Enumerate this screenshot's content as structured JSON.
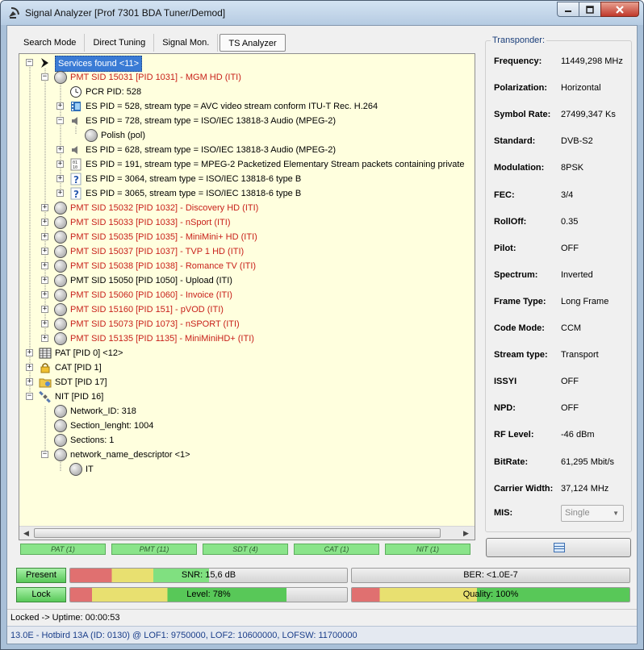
{
  "window": {
    "title": "Signal Analyzer [Prof 7301 BDA Tuner/Demod]"
  },
  "tabs": [
    {
      "label": "Search Mode"
    },
    {
      "label": "Direct Tuning"
    },
    {
      "label": "Signal Mon."
    },
    {
      "label": "TS Analyzer"
    }
  ],
  "tree": {
    "rows": [
      {
        "label": "Services found <11>"
      },
      {
        "label": "PMT SID 15031 [PID 1031] - MGM HD (ITI)"
      },
      {
        "label": "PCR PID: 528"
      },
      {
        "label": "ES PID = 528, stream type = AVC video stream conform ITU-T Rec. H.264"
      },
      {
        "label": "ES PID = 728, stream type = ISO/IEC 13818-3 Audio (MPEG-2)"
      },
      {
        "label": "Polish (pol)"
      },
      {
        "label": "ES PID = 628, stream type = ISO/IEC 13818-3 Audio (MPEG-2)"
      },
      {
        "label": "ES PID = 191, stream type = MPEG-2 Packetized Elementary Stream packets containing private"
      },
      {
        "label": "ES PID = 3064, stream type = ISO/IEC 13818-6 type B"
      },
      {
        "label": "ES PID = 3065, stream type = ISO/IEC 13818-6 type B"
      },
      {
        "label": "PMT SID 15032 [PID 1032] - Discovery HD (ITI)"
      },
      {
        "label": "PMT SID 15033 [PID 1033] - nSport (ITI)"
      },
      {
        "label": "PMT SID 15035 [PID 1035] - MiniMini+ HD (ITI)"
      },
      {
        "label": "PMT SID 15037 [PID 1037] - TVP 1 HD (ITI)"
      },
      {
        "label": "PMT SID 15038 [PID 1038] - Romance TV (ITI)"
      },
      {
        "label": "PMT SID 15050 [PID 1050] - Upload (ITI)"
      },
      {
        "label": "PMT SID 15060 [PID 1060] - Invoice (ITI)"
      },
      {
        "label": "PMT SID 15160 [PID 151] - pVOD (ITI)"
      },
      {
        "label": "PMT SID 15073 [PID 1073] - nSPORT (ITI)"
      },
      {
        "label": "PMT SID 15135 [PID 1135] - MiniMiniHD+ (ITI)"
      },
      {
        "label": "PAT [PID 0] <12>"
      },
      {
        "label": "CAT [PID 1]"
      },
      {
        "label": "SDT [PID 17]"
      },
      {
        "label": "NIT [PID 16]"
      },
      {
        "label": "Network_ID: 318"
      },
      {
        "label": "Section_lenght: 1004"
      },
      {
        "label": "Sections: 1"
      },
      {
        "label": "network_name_descriptor <1>"
      },
      {
        "label": "IT"
      }
    ]
  },
  "stat_boxes": [
    {
      "label": "PAT (1)"
    },
    {
      "label": "PMT (11)"
    },
    {
      "label": "SDT (4)"
    },
    {
      "label": "CAT (1)"
    },
    {
      "label": "NIT (1)"
    }
  ],
  "transponder": {
    "title": "Transponder:",
    "fields": [
      {
        "key": "Frequency:",
        "value": "11449,298 MHz"
      },
      {
        "key": "Polarization:",
        "value": "Horizontal"
      },
      {
        "key": "Symbol Rate:",
        "value": "27499,347 Ks"
      },
      {
        "key": "Standard:",
        "value": "DVB-S2"
      },
      {
        "key": "Modulation:",
        "value": "8PSK"
      },
      {
        "key": "FEC:",
        "value": "3/4"
      },
      {
        "key": "RollOff:",
        "value": "0.35"
      },
      {
        "key": "Pilot:",
        "value": "OFF"
      },
      {
        "key": "Spectrum:",
        "value": "Inverted"
      },
      {
        "key": "Frame Type:",
        "value": "Long Frame"
      },
      {
        "key": "Code Mode:",
        "value": "CCM"
      },
      {
        "key": "Stream type:",
        "value": "Transport"
      },
      {
        "key": "ISSYI",
        "value": "OFF"
      },
      {
        "key": "NPD:",
        "value": "OFF"
      },
      {
        "key": "RF Level:",
        "value": "-46 dBm"
      },
      {
        "key": "BitRate:",
        "value": "61,295 Mbit/s"
      },
      {
        "key": "Carrier Width:",
        "value": "37,124 MHz"
      }
    ],
    "mis": {
      "key": "MIS:",
      "value": "Single"
    }
  },
  "signal": {
    "present_label": "Present",
    "lock_label": "Lock",
    "snr": {
      "label": "SNR: 15,6 dB",
      "level": 0.5
    },
    "ber": {
      "label": "BER: <1.0E-7",
      "level": 0
    },
    "level": {
      "label": "Level: 78%",
      "level": 0.78
    },
    "quality": {
      "label": "Quality: 100%",
      "level": 1.0
    }
  },
  "status": {
    "line1": "Locked -> Uptime: 00:00:53",
    "line2": "13.0E - Hotbird 13A (ID: 0130) @ LOF1: 9750000, LOF2: 10600000, LOFSW: 11700000"
  },
  "colors": {
    "service_red": "#c8201a",
    "status_green": "#58c858",
    "selection_blue": "#3a7bd5"
  }
}
